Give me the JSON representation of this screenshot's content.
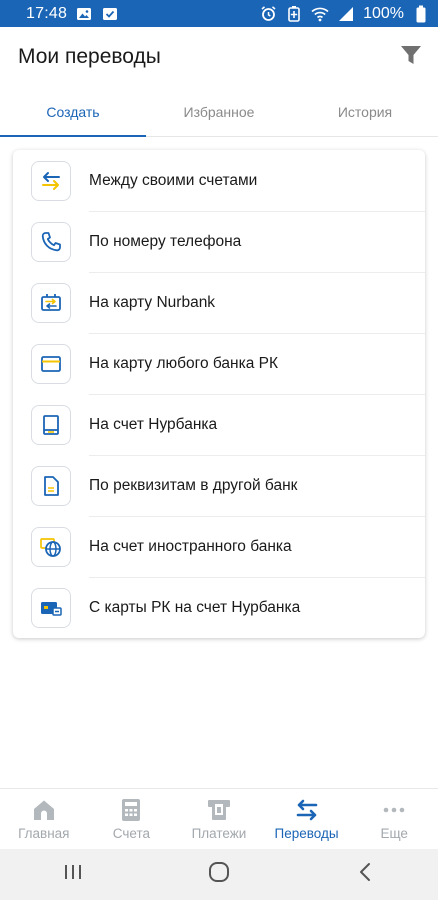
{
  "status_bar": {
    "time": "17:48",
    "battery": "100%",
    "icons_left": [
      "image-icon",
      "check-box-icon"
    ],
    "icons_right": [
      "alarm-icon",
      "battery-saver-icon",
      "wifi-icon",
      "signal-icon",
      "battery-icon"
    ]
  },
  "header": {
    "title": "Мои переводы",
    "filter_icon": "filter-icon"
  },
  "tabs": [
    {
      "label": "Создать",
      "active": true
    },
    {
      "label": "Избранное",
      "active": false
    },
    {
      "label": "История",
      "active": false
    }
  ],
  "transfers": [
    {
      "label": "Между своими счетами",
      "icon": "swap-arrows-icon"
    },
    {
      "label": "По номеру телефона",
      "icon": "phone-icon"
    },
    {
      "label": "На карту Nurbank",
      "icon": "card-transfer-icon"
    },
    {
      "label": "На карту любого банка РК",
      "icon": "credit-card-icon"
    },
    {
      "label": "На счет Нурбанка",
      "icon": "book-icon"
    },
    {
      "label": "По реквизитам в другой банк",
      "icon": "document-icon"
    },
    {
      "label": "На счет иностранного банка",
      "icon": "globe-icon"
    },
    {
      "label": "С карты РК на счет Нурбанка",
      "icon": "card-to-account-icon"
    }
  ],
  "bottom_nav": [
    {
      "label": "Главная",
      "icon": "home-icon",
      "active": false
    },
    {
      "label": "Счета",
      "icon": "calculator-icon",
      "active": false
    },
    {
      "label": "Платежи",
      "icon": "payment-terminal-icon",
      "active": false
    },
    {
      "label": "Переводы",
      "icon": "transfer-arrows-icon",
      "active": true
    },
    {
      "label": "Еще",
      "icon": "more-dots-icon",
      "active": false
    }
  ],
  "colors": {
    "primary": "#1b65b6",
    "accent_yellow": "#f5c400",
    "inactive": "#a3a8ad"
  }
}
